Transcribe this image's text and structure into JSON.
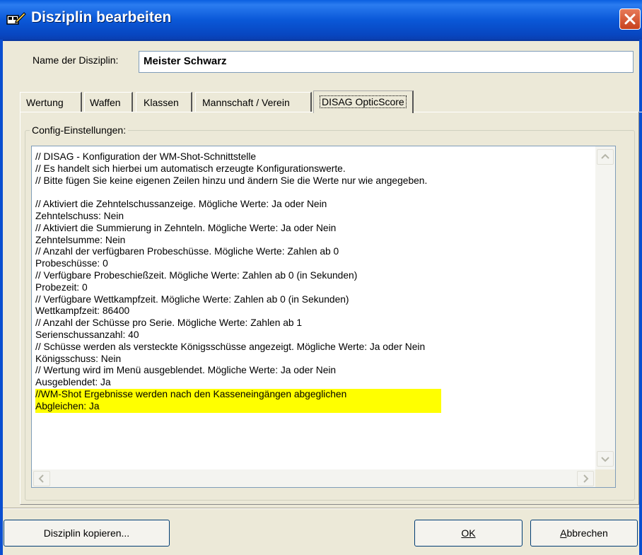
{
  "window": {
    "title": "Disziplin bearbeiten",
    "title_icon": "edit-discipline-icon",
    "close_icon": "close-icon",
    "titlebar_color": "#0a58d8",
    "close_color": "#d4512e"
  },
  "name_row": {
    "label": "Name der Disziplin:",
    "value": "Meister Schwarz"
  },
  "tabs": [
    {
      "label": "Wertung",
      "selected": false
    },
    {
      "label": "Waffen",
      "selected": false
    },
    {
      "label": "Klassen",
      "selected": false
    },
    {
      "label": "Mannschaft / Verein",
      "selected": false
    },
    {
      "label": "DISAG OpticScore",
      "selected": true
    }
  ],
  "config": {
    "group_label": "Config-Einstellungen:",
    "highlight_color": "#ffff00",
    "lines": [
      "// DISAG - Konfiguration der WM-Shot-Schnittstelle",
      "// Es handelt sich hierbei um automatisch erzeugte Konfigurationswerte.",
      "// Bitte fügen Sie keine eigenen Zeilen hinzu und ändern Sie die Werte nur wie angegeben.",
      "",
      "// Aktiviert die Zehntelschussanzeige. Mögliche Werte: Ja oder Nein",
      "Zehntelschuss: Nein",
      "// Aktiviert die Summierung in Zehnteln. Mögliche Werte: Ja oder Nein",
      "Zehntelsumme: Nein",
      "// Anzahl der verfügbaren Probeschüsse. Mögliche Werte: Zahlen ab 0",
      "Probeschüsse: 0",
      "// Verfügbare Probeschießzeit. Mögliche Werte: Zahlen ab 0 (in Sekunden)",
      "Probezeit: 0",
      "// Verfügbare Wettkampfzeit. Mögliche Werte: Zahlen ab 0 (in Sekunden)",
      "Wettkampfzeit: 86400",
      "// Anzahl der Schüsse pro Serie. Mögliche Werte: Zahlen ab 1",
      "Serienschussanzahl: 40",
      "// Schüsse werden als versteckte Königsschüsse angezeigt. Mögliche Werte: Ja oder Nein",
      "Königsschuss: Nein",
      "// Wertung wird im Menü ausgeblendet. Mögliche Werte: Ja oder Nein",
      "Ausgeblendet: Ja",
      "//WM-Shot Ergebnisse werden nach den Kasseneingängen abgeglichen",
      "Abgleichen: Ja"
    ],
    "highlighted_lines": [
      20,
      21
    ]
  },
  "buttons": {
    "copy": "Disziplin kopieren...",
    "ok": "OK",
    "cancel": "Abbrechen"
  },
  "icons": {
    "scroll_up": "scroll-up-arrow-icon",
    "scroll_down": "scroll-down-arrow-icon",
    "scroll_left": "scroll-left-arrow-icon",
    "scroll_right": "scroll-right-arrow-icon"
  }
}
